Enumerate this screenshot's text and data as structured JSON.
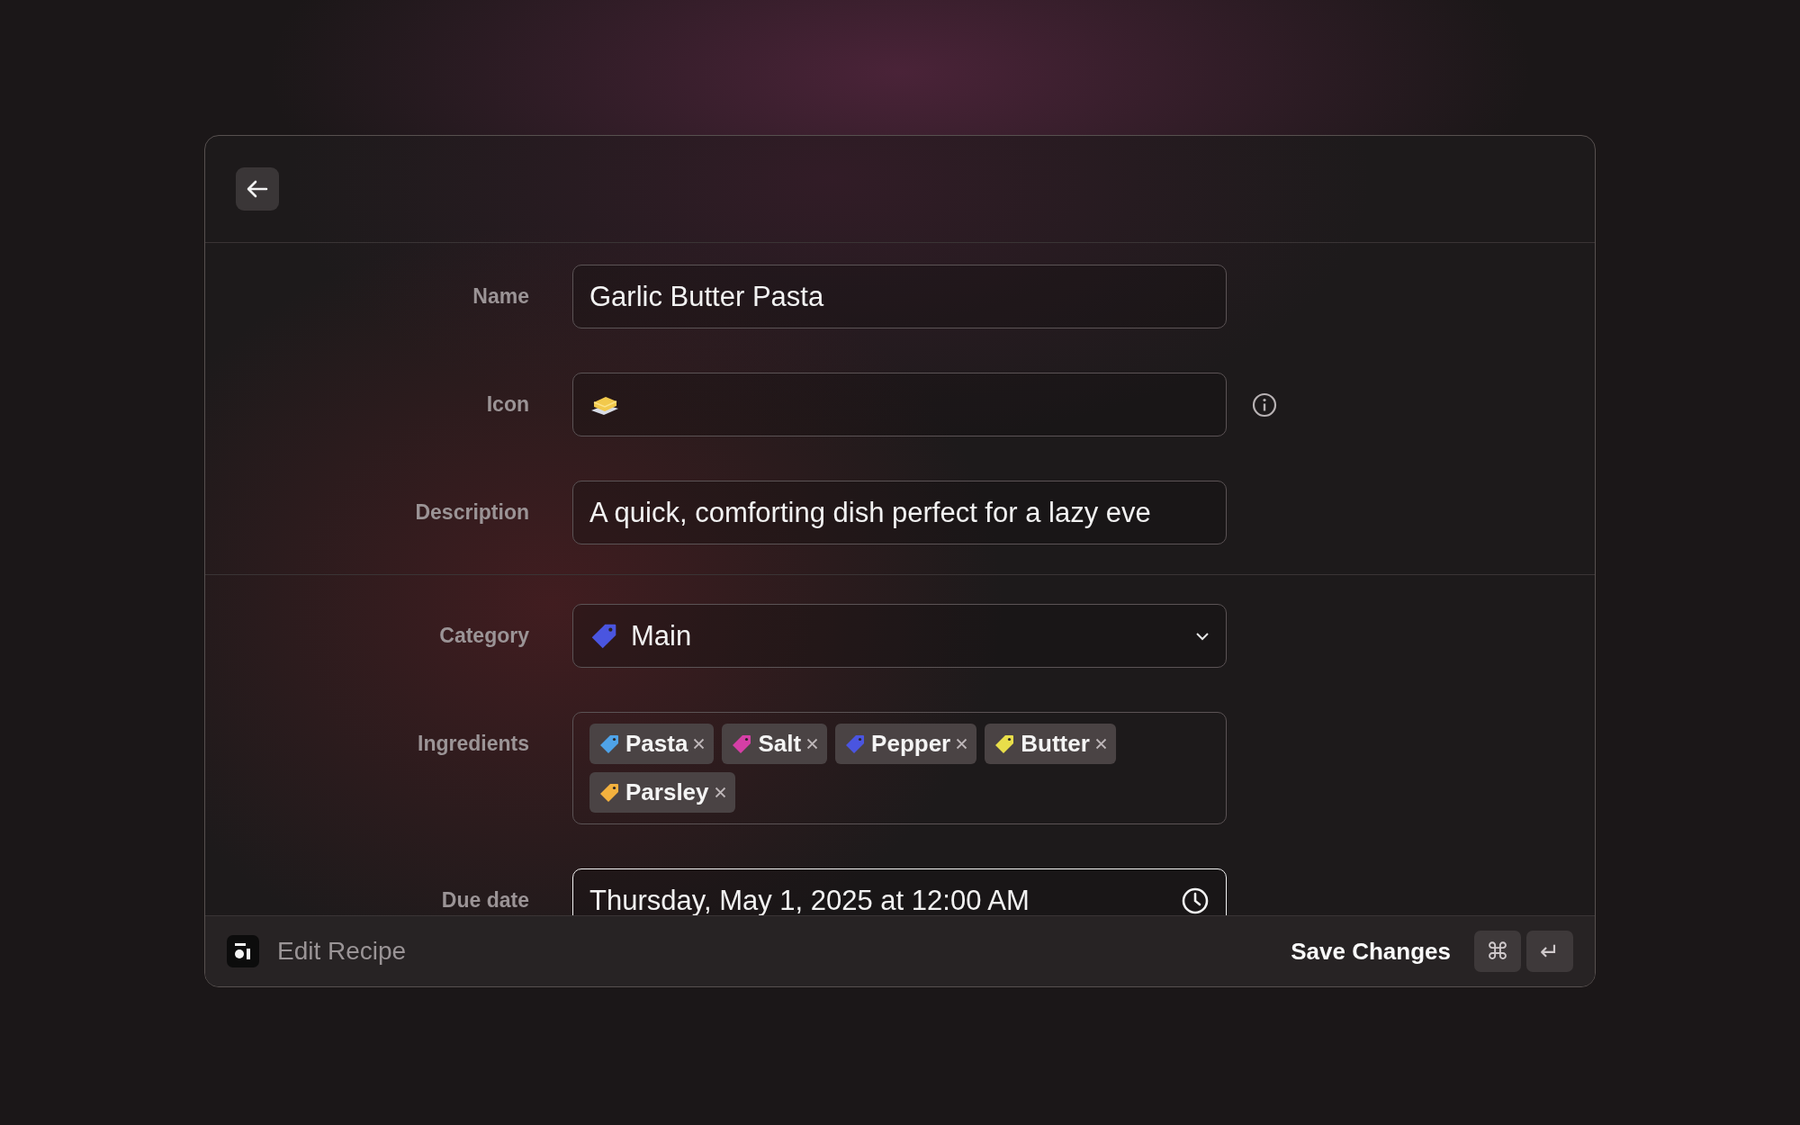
{
  "header": {
    "back_button": true
  },
  "fields": [
    {
      "kind": "text",
      "label": "Name",
      "value": "Garlic Butter Pasta"
    },
    {
      "kind": "icon",
      "label": "Icon",
      "info": true
    },
    {
      "kind": "text",
      "label": "Description",
      "value": "A quick, comforting dish perfect for a lazy eve"
    }
  ],
  "fields_2": [
    {
      "kind": "select",
      "label": "Category",
      "value": "Main",
      "color": "#4a55e0"
    },
    {
      "kind": "tags",
      "label": "Ingredients",
      "tags": [
        {
          "label": "Pasta",
          "color": "#4fa3e8"
        },
        {
          "label": "Salt",
          "color": "#d53fa6"
        },
        {
          "label": "Pepper",
          "color": "#4a55e0"
        },
        {
          "label": "Butter",
          "color": "#e8de4a"
        },
        {
          "label": "Parsley",
          "color": "#f3b13e"
        }
      ]
    },
    {
      "kind": "date",
      "label": "Due date",
      "value": "Thursday, May 1, 2025 at 12:00 AM",
      "focused": true
    }
  ],
  "footer": {
    "title": "Edit Recipe",
    "action": "Save Changes",
    "keys": [
      "⌘",
      "↵"
    ]
  }
}
